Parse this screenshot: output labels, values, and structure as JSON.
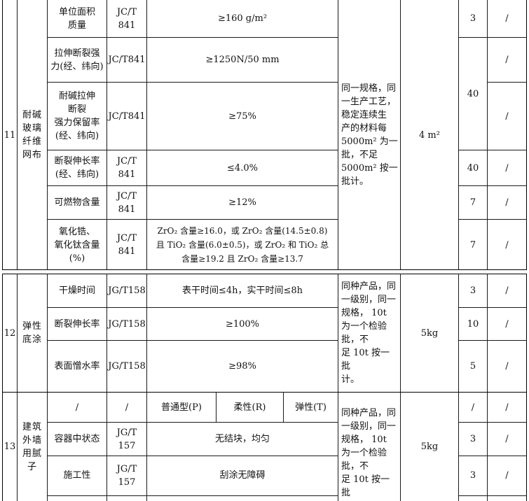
{
  "sections": [
    {
      "no": "11",
      "name": "耐碱\n玻璃\n纤维\n网布",
      "batch": "同一规格，同\n一生产工艺，\n稳定连续生\n产的材料每\n5000m² 为一\n批，不足\n5000m² 按一\n批计。",
      "sample": "4 m²",
      "rows": [
        {
          "item": "单位面积\n质量",
          "std": "JC/T\n841",
          "req": "≥160 g/m²",
          "qty": "3",
          "extra": "/"
        },
        {
          "item": "拉伸断裂强\n力(经、纬向)",
          "std": "JC/T841",
          "req": "≥1250N/50 mm",
          "qty": "",
          "extra": "/"
        },
        {
          "item": "耐碱拉伸\n断裂\n强力保留率\n(经、纬向)",
          "std": "JC/T841",
          "req": "≥75%",
          "qty": "40",
          "extra": "/"
        },
        {
          "item": "断裂伸长率\n(经、纬向)",
          "std": "JC/T\n841",
          "req": "≤4.0%",
          "qty": "40",
          "extra": "/"
        },
        {
          "item": "可燃物含量",
          "std": "JC/T\n841",
          "req": "≥12%",
          "qty": "7",
          "extra": "/"
        },
        {
          "item": "氧化锆、\n氧化钛含量\n(%)",
          "std": "JC/T\n841",
          "req": "ZrO₂ 含量≥16.0，或 ZrO₂ 含量(14.5±0.8)\n且 TiO₂ 含量(6.0±0.5)，或 ZrO₂ 和 TiO₂ 总\n含量≥19.2 且 ZrO₂ 含量≥13.7",
          "qty": "7",
          "extra": "/"
        }
      ]
    },
    {
      "no": "12",
      "name": "弹性\n底涂",
      "batch": "同种产品，同\n一级别，同一\n规格，  10t\n为一个检验\n批，不\n足 10t 按一批\n计。",
      "sample": "5kg",
      "rows": [
        {
          "item": "干燥时间",
          "std": "JG/T158",
          "req": "表干时间≤4h，实干时间≤8h",
          "qty": "3",
          "extra": "/"
        },
        {
          "item": "断裂伸长率",
          "std": "JG/T158",
          "req": "≥100%",
          "qty": "10",
          "extra": "/"
        },
        {
          "item": "表面憎水率",
          "std": "JG/T158",
          "req": "≥98%",
          "qty": "5",
          "extra": "/"
        }
      ]
    },
    {
      "no": "13",
      "name": "建筑\n外墙\n用腻\n子",
      "batch": "同种产品，同\n一级别，同一\n规格，  10t\n为一个检验\n批，不\n足 10t 按一批",
      "sample": "5kg",
      "header_row": {
        "item": "/",
        "std": "/",
        "types": [
          "普通型(P)",
          "柔性(R)",
          "弹性(T)"
        ],
        "qty": "/",
        "extra": "/"
      },
      "rows": [
        {
          "item": "容器中状态",
          "std": "JG/T\n157",
          "req": "无结块，均匀",
          "qty": "3",
          "extra": "/"
        },
        {
          "item": "施工性",
          "std": "JG/T\n157",
          "req": "刮涂无障碍",
          "qty": "3",
          "extra": "/"
        }
      ]
    }
  ]
}
